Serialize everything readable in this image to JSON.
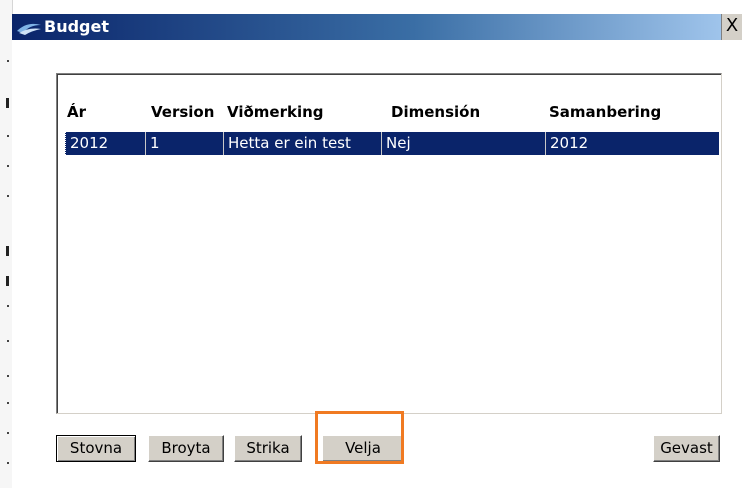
{
  "window": {
    "title": "Budget",
    "close_label": "X"
  },
  "table": {
    "headers": [
      "Ár",
      "Version",
      "Viðmerking",
      "Dimensión",
      "Samanbering"
    ],
    "rows": [
      [
        "2012",
        "1",
        "Hetta er ein test",
        "Nej",
        "2012"
      ]
    ],
    "selected_row": 0
  },
  "buttons": {
    "stovna": "Stovna",
    "broyta": "Broyta",
    "strika": "Strika",
    "velja": "Velja",
    "gevast": "Gevast"
  },
  "colors": {
    "selection": "#0a246a",
    "highlight_box": "#f07a22",
    "titlebar_start": "#0a246a",
    "titlebar_end": "#a6caf0"
  },
  "icons": {
    "title": "app-icon"
  }
}
